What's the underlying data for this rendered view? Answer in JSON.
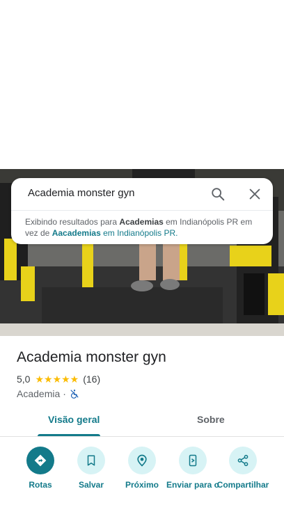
{
  "search": {
    "query": "Academia monster gyn",
    "suggestion_prefix": "Exibindo resultados para ",
    "suggestion_term": "Academias",
    "suggestion_mid": " em Indianópolis PR em vez de ",
    "suggestion_original": "Aacademias",
    "suggestion_suffix": " em Indianópolis PR."
  },
  "place": {
    "name": "Academia monster gyn",
    "rating": "5,0",
    "stars": "★★★★★",
    "star_count_value": 5,
    "review_count": "(16)",
    "category": "Academia",
    "separator": "·"
  },
  "tabs": [
    {
      "label": "Visão geral",
      "active": true
    },
    {
      "label": "Sobre",
      "active": false
    }
  ],
  "actions": [
    {
      "label": "Rotas",
      "icon": "directions-icon"
    },
    {
      "label": "Salvar",
      "icon": "bookmark-icon"
    },
    {
      "label": "Próximo",
      "icon": "nearby-icon"
    },
    {
      "label": "Enviar para o",
      "icon": "send-to-phone-icon"
    },
    {
      "label": "Compartilhar",
      "icon": "share-icon"
    }
  ],
  "colors": {
    "accent": "#137a8a",
    "action_bg": "#d7f3f5",
    "star": "#fbbc04"
  }
}
